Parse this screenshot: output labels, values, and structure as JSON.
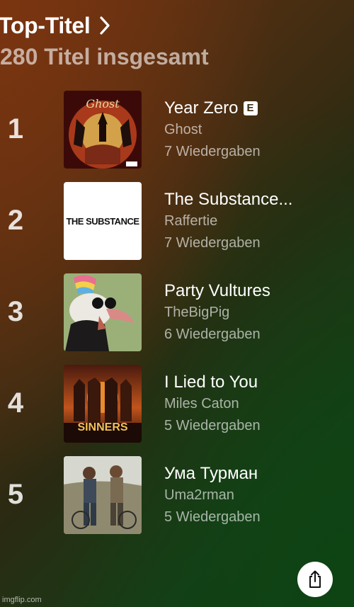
{
  "header": {
    "title": "Top-Titel",
    "subtitle": "280 Titel insgesamt"
  },
  "tracks": [
    {
      "rank": "1",
      "title": "Year Zero",
      "explicit": true,
      "explicit_badge": "E",
      "artist": "Ghost",
      "plays": "7 Wiedergaben",
      "cover_text": ""
    },
    {
      "rank": "2",
      "title": "The Substance...",
      "explicit": false,
      "explicit_badge": "",
      "artist": "Raffertie",
      "plays": "7 Wiedergaben",
      "cover_text": "THE SUBSTANCE"
    },
    {
      "rank": "3",
      "title": "Party Vultures",
      "explicit": false,
      "explicit_badge": "",
      "artist": "TheBigPig",
      "plays": "6 Wiedergaben",
      "cover_text": ""
    },
    {
      "rank": "4",
      "title": "I Lied to You",
      "explicit": false,
      "explicit_badge": "",
      "artist": "Miles Caton",
      "plays": "5 Wiedergaben",
      "cover_text": "SINNERS"
    },
    {
      "rank": "5",
      "title": "Ума Турман",
      "explicit": false,
      "explicit_badge": "",
      "artist": "Uma2rman",
      "plays": "5 Wiedergaben",
      "cover_text": ""
    }
  ],
  "share": {
    "icon": "share-icon"
  },
  "watermark": "imgflip.com"
}
